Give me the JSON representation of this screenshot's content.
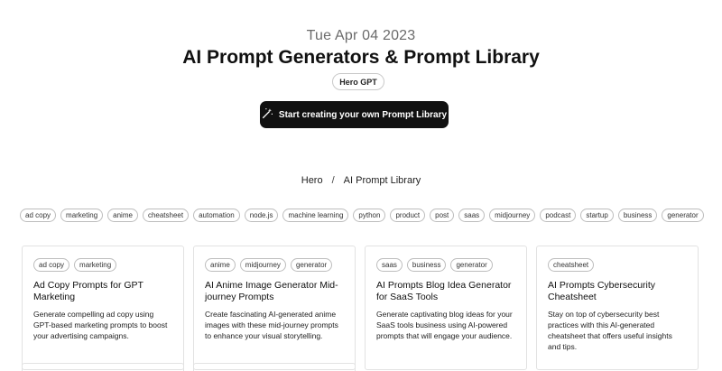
{
  "header": {
    "date": "Tue Apr 04 2023",
    "title": "AI Prompt Generators & Prompt Library",
    "author_badge": "Hero GPT",
    "cta_label": "Start creating your own Prompt Library",
    "cta_icon": "magic-wand-icon"
  },
  "breadcrumb": {
    "items": [
      "Hero",
      "AI Prompt Library"
    ],
    "separator": "/"
  },
  "tags": [
    "ad copy",
    "marketing",
    "anime",
    "cheatsheet",
    "automation",
    "node.js",
    "machine learning",
    "python",
    "product",
    "post",
    "saas",
    "midjourney",
    "podcast",
    "startup",
    "business",
    "generator"
  ],
  "cards": [
    {
      "tags": [
        "ad copy",
        "marketing"
      ],
      "title": "Ad Copy Prompts for GPT Marketing",
      "description": "Generate compelling ad copy using GPT-based marketing prompts to boost your advertising campaigns."
    },
    {
      "tags": [
        "anime",
        "midjourney",
        "generator"
      ],
      "title": "AI Anime Image Generator Mid-journey Prompts",
      "description": "Create fascinating AI-generated anime images with these mid-journey prompts to enhance your visual storytelling."
    },
    {
      "tags": [
        "saas",
        "business",
        "generator"
      ],
      "title": "AI Prompts Blog Idea Generator for SaaS Tools",
      "description": "Generate captivating blog ideas for your SaaS tools business using AI-powered prompts that will engage your audience."
    },
    {
      "tags": [
        "cheatsheet"
      ],
      "title": "AI Prompts Cybersecurity Cheatsheet",
      "description": "Stay on top of cybersecurity best practices with this AI-generated cheatsheet that offers useful insights and tips."
    }
  ]
}
